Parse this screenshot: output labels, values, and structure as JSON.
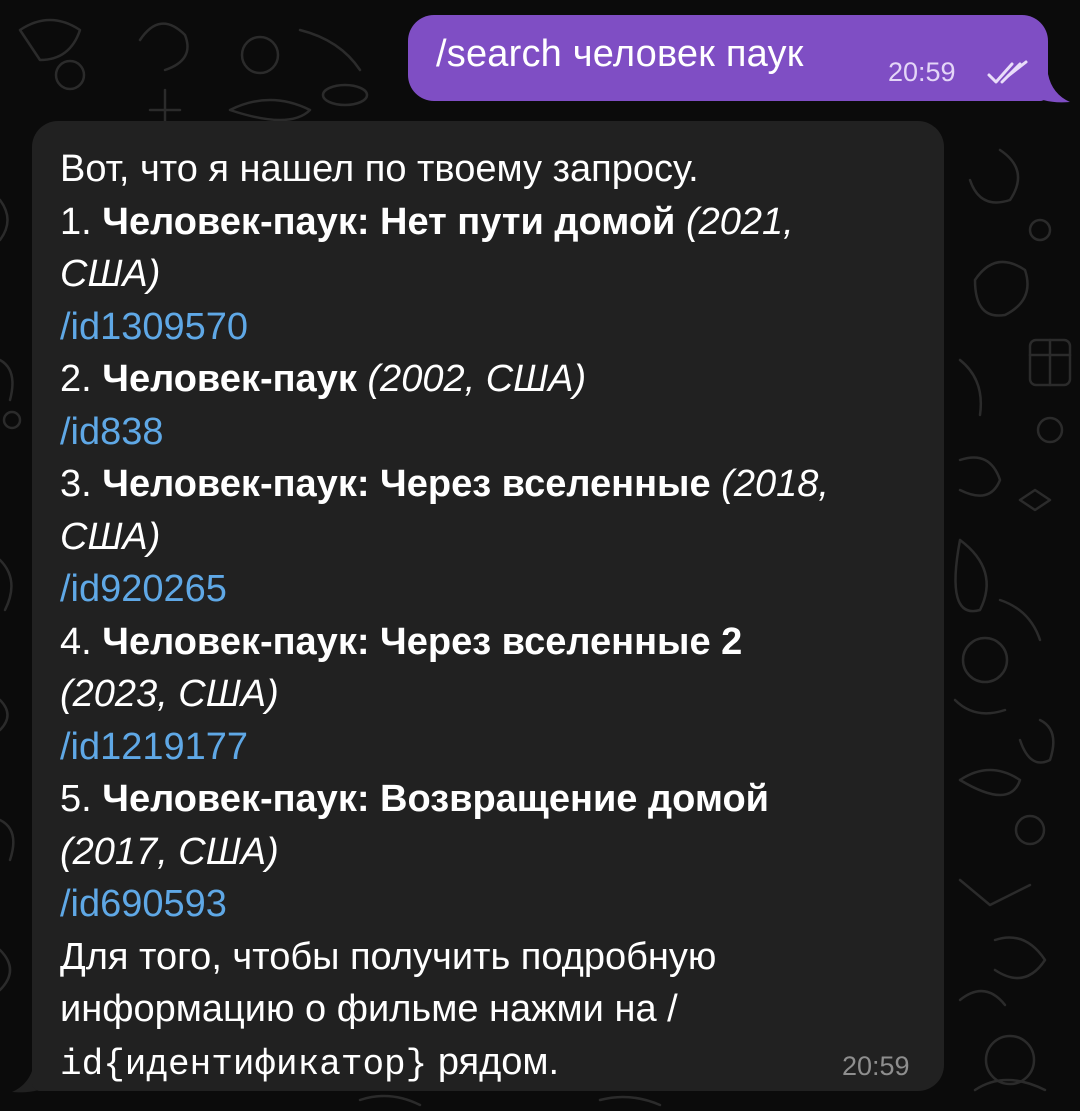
{
  "outgoing": {
    "text": "/search человек паук",
    "time": "20:59"
  },
  "incoming": {
    "intro": "Вот, что я нашел по твоему запросу.",
    "results": [
      {
        "number": "1. ",
        "title": "Человек-паук: Нет пути домой",
        "meta_part1": " (2021,",
        "meta_part2": "США)",
        "id": "/id1309570"
      },
      {
        "number": "2. ",
        "title": "Человек-паук",
        "meta": " (2002, США)",
        "id": "/id838"
      },
      {
        "number": "3. ",
        "title": "Человек-паук: Через вселенные",
        "meta_part1": " (2018,",
        "meta_part2": "США)",
        "id": "/id920265"
      },
      {
        "number": "4. ",
        "title": "Человек-паук: Через вселенные 2",
        "meta": "(2023, США)",
        "id": "/id1219177"
      },
      {
        "number": "5. ",
        "title": "Человек-паук: Возвращение домой",
        "meta": "(2017, США)",
        "id": "/id690593"
      }
    ],
    "footer_line1": "Для того, чтобы получить подробную",
    "footer_line2": "информацию о фильме нажми на /",
    "footer_line3_code": "id{идентификатор}",
    "footer_line3_rest": " рядом.",
    "time": "20:59"
  }
}
